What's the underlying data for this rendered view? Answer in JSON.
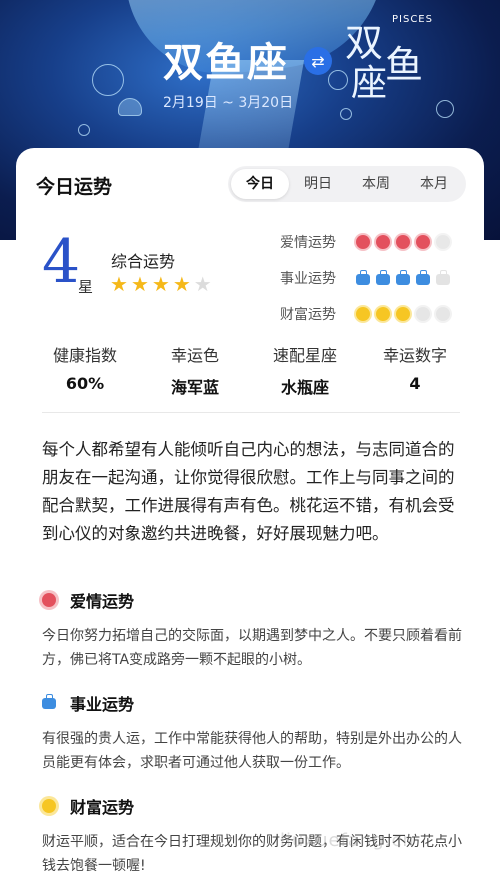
{
  "hero": {
    "title": "双鱼座",
    "glyph": [
      "双",
      "鱼",
      "座"
    ],
    "english": "PISCES",
    "date_range": "2月19日 ~ 3月20日",
    "swap_icon": "swap-arrows"
  },
  "header": {
    "title": "今日运势",
    "tabs": [
      "今日",
      "明日",
      "本周",
      "本月"
    ],
    "active_tab": "今日"
  },
  "overall": {
    "score": "4",
    "unit": "星",
    "label": "综合运势",
    "stars": 4,
    "max_stars": 5
  },
  "ratings": [
    {
      "label": "爱情运势",
      "icon": "flower",
      "value": 4,
      "max": 5
    },
    {
      "label": "事业运势",
      "icon": "briefcase",
      "value": 4,
      "max": 5
    },
    {
      "label": "财富运势",
      "icon": "coin",
      "value": 3,
      "max": 5
    }
  ],
  "stats": [
    {
      "label": "健康指数",
      "value": "60%"
    },
    {
      "label": "幸运色",
      "value": "海军蓝"
    },
    {
      "label": "速配星座",
      "value": "水瓶座"
    },
    {
      "label": "幸运数字",
      "value": "4"
    }
  ],
  "summary": "每个人都希望有人能倾听自己内心的想法，与志同道合的朋友在一起沟通，让你觉得很欣慰。工作上与同事之间的配合默契，工作进展得有声有色。桃花运不错，有机会受到心仪的对象邀约共进晚餐，好好展现魅力吧。",
  "sections": [
    {
      "title": "爱情运势",
      "icon": "flower",
      "body": "今日你努力拓增自己的交际面，以期遇到梦中之人。不要只顾着看前方，佛已将TA变成路旁一颗不起眼的小树。"
    },
    {
      "title": "事业运势",
      "icon": "briefcase",
      "body": "有很强的贵人运，工作中常能获得他人的帮助，特别是外出办公的人员能更有体会，求职者可通过他人获取一份工作。"
    },
    {
      "title": "财富运势",
      "icon": "coin",
      "body": "财运平顺，适合在今日打理规划你的财务问题，有闲钱时不妨花点小钱去饱餐一顿喔!"
    }
  ],
  "watermark": "liuxuefang.cn",
  "colors": {
    "accent": "#2a52c8",
    "star": "#f5b819",
    "love": "#e3505d",
    "career": "#3d8de0",
    "wealth": "#f6c623"
  }
}
